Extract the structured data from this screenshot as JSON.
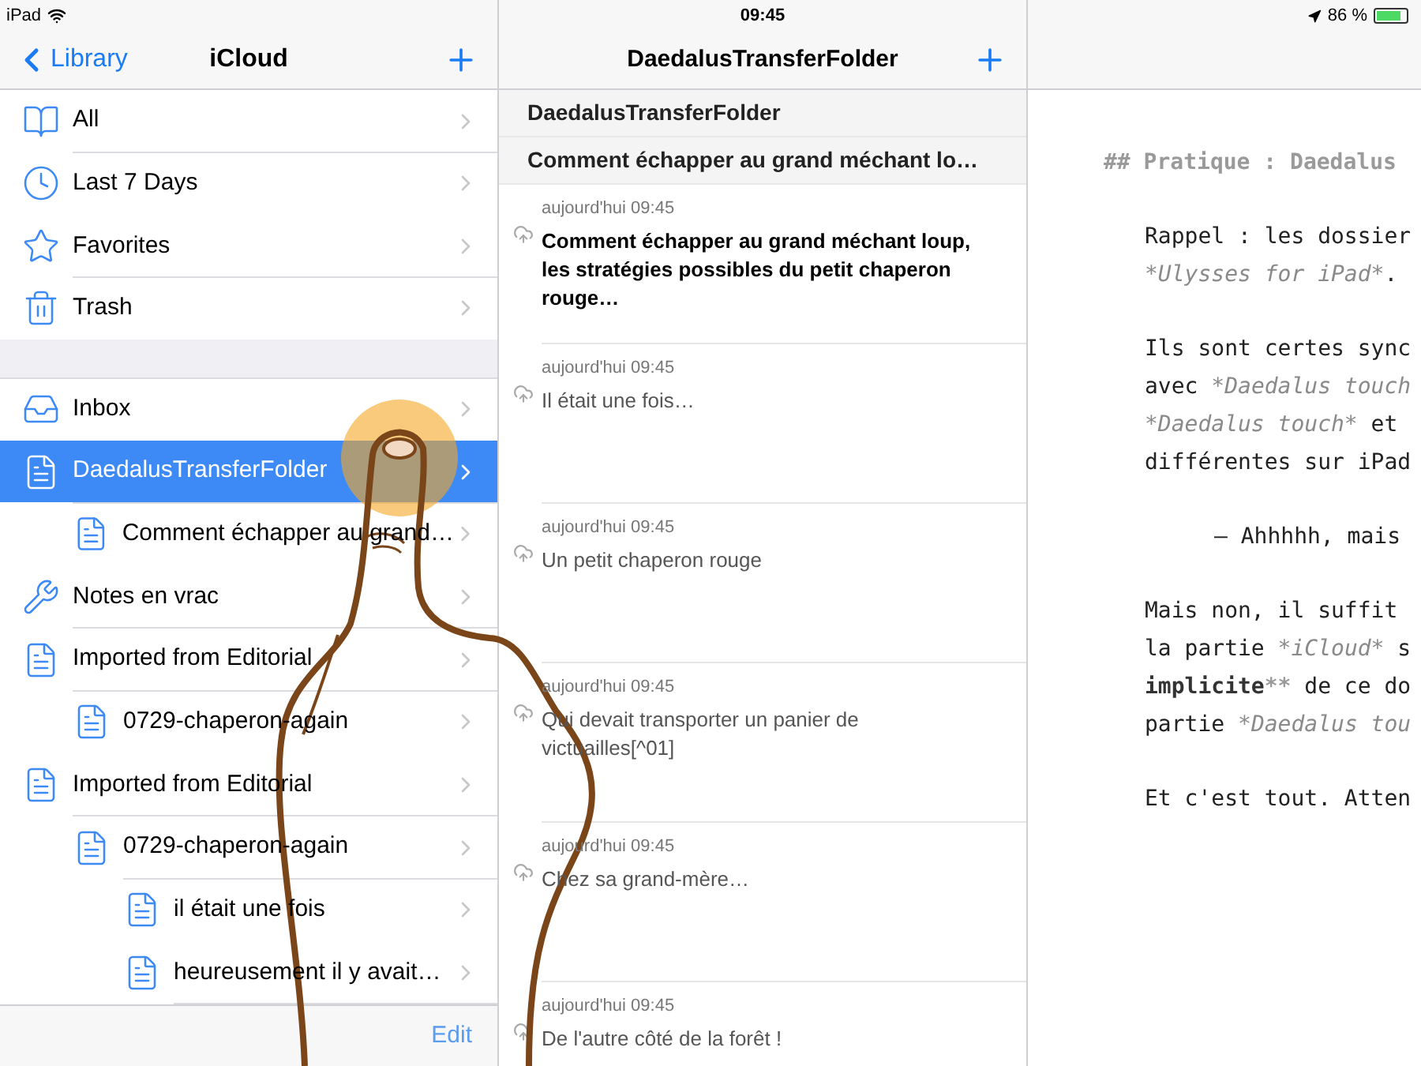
{
  "status_bar": {
    "device": "iPad",
    "time": "09:45",
    "battery": "86 %"
  },
  "sidebar": {
    "back": "Library",
    "title": "iCloud",
    "groups": [
      [
        {
          "label": "All",
          "selected": false
        },
        {
          "label": "Last 7 Days",
          "selected": false
        },
        {
          "label": "Favorites",
          "selected": false
        },
        {
          "label": "Trash",
          "selected": false
        }
      ],
      [
        {
          "label": "Inbox",
          "selected": false
        },
        {
          "label": "DaedalusTransferFolder",
          "selected": true,
          "children": [
            {
              "label": "Comment échapper au grand…",
              "selected": false
            }
          ]
        },
        {
          "label": "Notes en vrac",
          "selected": false
        },
        {
          "label": "Imported from Editorial",
          "selected": false,
          "children": [
            {
              "label": "0729-chaperon-again",
              "selected": false
            }
          ]
        },
        {
          "label": "Imported from Editorial",
          "selected": false,
          "children": [
            {
              "label": "0729-chaperon-again",
              "selected": false,
              "children": [
                {
                  "label": "il était une fois",
                  "selected": false
                },
                {
                  "label": "heureusement il y avait…",
                  "selected": false
                }
              ]
            }
          ]
        }
      ]
    ],
    "edit": "Edit"
  },
  "sheets": {
    "title": "DaedalusTransferFolder",
    "breadcrumbs": [
      "DaedalusTransferFolder",
      "Comment échapper au grand méchant lo…"
    ],
    "items": [
      {
        "date": "aujourd'hui 09:45",
        "text": "Comment échapper au grand méchant loup, les stratégies possibles du petit chaperon rouge…",
        "kind": "heading"
      },
      {
        "date": "aujourd'hui 09:45",
        "text": "Il était une fois…",
        "kind": "text"
      },
      {
        "date": "aujourd'hui 09:45",
        "text": "Un petit chaperon rouge",
        "kind": "text"
      },
      {
        "date": "aujourd'hui 09:45",
        "text": "Qui devait transporter un panier de victuailles[^01]",
        "kind": "text"
      },
      {
        "date": "aujourd'hui 09:45",
        "text": "Chez sa grand-mère…",
        "kind": "text"
      },
      {
        "date": "aujourd'hui 09:45",
        "text": "De l'autre côté de la forêt !",
        "kind": "text"
      }
    ]
  },
  "editor": {
    "paragraphs": [
      {
        "kind": "heading",
        "lines": [
          [
            {
              "text": "## ",
              "kind": "markup"
            },
            {
              "text": "Pratique : Daedalus",
              "kind": "heading"
            }
          ]
        ]
      },
      {
        "kind": "body",
        "lines": [
          [
            {
              "text": "Rappel : les dossier",
              "kind": "plain"
            }
          ],
          [
            {
              "text": "*Ulysses for iPad*",
              "kind": "emph"
            },
            {
              "text": ".",
              "kind": "plain"
            }
          ]
        ]
      },
      {
        "kind": "body",
        "lines": [
          [
            {
              "text": "Ils sont certes sync",
              "kind": "plain"
            }
          ],
          [
            {
              "text": "avec ",
              "kind": "plain"
            },
            {
              "text": "*Daedalus touch",
              "kind": "emph"
            }
          ],
          [
            {
              "text": "*Daedalus touch*",
              "kind": "emph"
            },
            {
              "text": " et",
              "kind": "plain"
            }
          ],
          [
            {
              "text": "différentes sur iPad",
              "kind": "plain"
            }
          ]
        ]
      },
      {
        "kind": "quote",
        "lines": [
          [
            {
              "text": "– Ahhhhh, mais",
              "kind": "plain"
            }
          ]
        ]
      },
      {
        "kind": "body",
        "lines": [
          [
            {
              "text": "Mais non, il suffit",
              "kind": "plain"
            }
          ],
          [
            {
              "text": "la partie ",
              "kind": "plain"
            },
            {
              "text": "*iCloud*",
              "kind": "emph"
            },
            {
              "text": " s",
              "kind": "plain"
            }
          ],
          [
            {
              "text": "implicite",
              "kind": "strong"
            },
            {
              "text": "**",
              "kind": "markup"
            },
            {
              "text": " de ce do",
              "kind": "plain"
            }
          ],
          [
            {
              "text": "partie ",
              "kind": "plain"
            },
            {
              "text": "*Daedalus tou",
              "kind": "emph"
            }
          ]
        ]
      },
      {
        "kind": "body",
        "lines": [
          [
            {
              "text": "Et c'est tout. Atten",
              "kind": "plain"
            }
          ]
        ]
      }
    ]
  }
}
